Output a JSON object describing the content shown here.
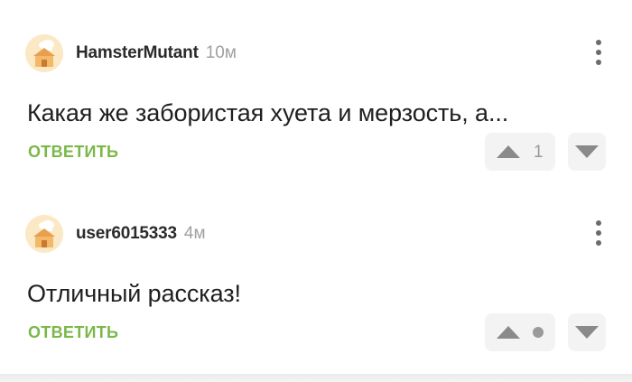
{
  "comments": [
    {
      "username": "HamsterMutant",
      "time": "10м",
      "text": "Какая же забористая хуета и мерзость, а...",
      "reply_label": "ОТВЕТИТЬ",
      "rating": "1",
      "rating_visible": true,
      "avatar_icon": "chef-house-avatar-icon"
    },
    {
      "username": "user6015333",
      "time": "4м",
      "text": "Отличный рассказ!",
      "reply_label": "ОТВЕТИТЬ",
      "rating": "",
      "rating_visible": false,
      "avatar_icon": "chef-house-avatar-icon"
    }
  ],
  "colors": {
    "reply_green": "#7ab848",
    "avatar_bg": "#fbe8c4",
    "vote_bg": "#f3f3f3",
    "icon_gray": "#8a8a8a"
  }
}
